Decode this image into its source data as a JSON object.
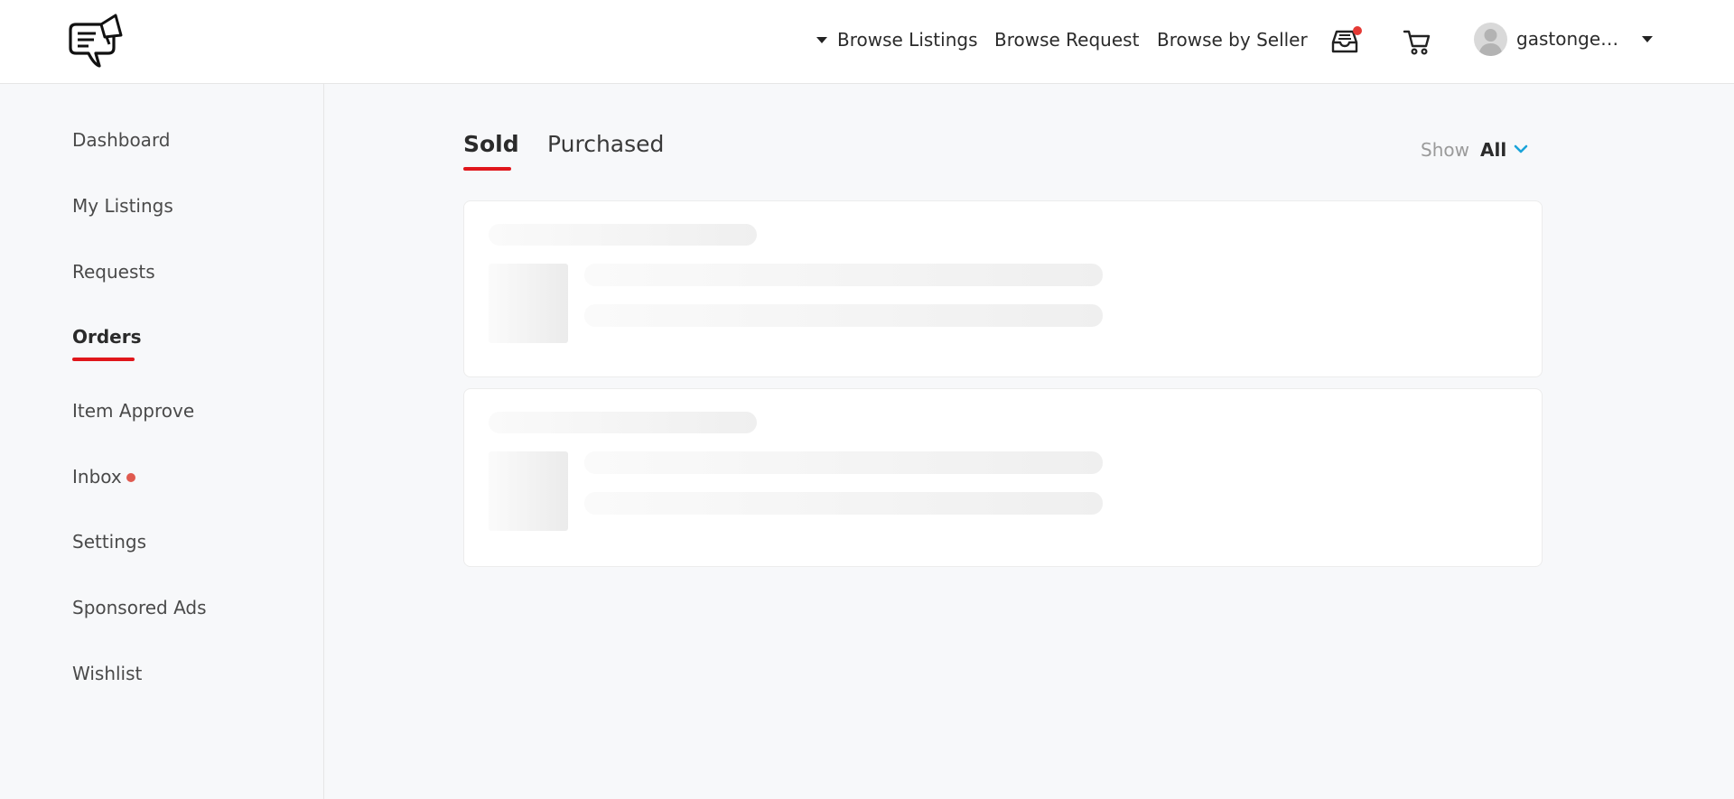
{
  "header": {
    "nav": {
      "browse_listings": "Browse Listings",
      "browse_request": "Browse Request",
      "browse_by_seller": "Browse by Seller"
    },
    "icons": {
      "logo": "megaphone-chat-logo",
      "inbox": "inbox-tray-icon",
      "cart": "shopping-cart-icon",
      "avatar": "user-avatar"
    },
    "inbox_has_notification": true,
    "username": "gastongena..."
  },
  "sidebar": {
    "items": [
      {
        "label": "Dashboard"
      },
      {
        "label": "My Listings"
      },
      {
        "label": "Requests"
      },
      {
        "label": "Orders",
        "active": true
      },
      {
        "label": "Item Approve"
      },
      {
        "label": "Inbox",
        "has_notification": true
      },
      {
        "label": "Settings"
      },
      {
        "label": "Sponsored Ads"
      },
      {
        "label": "Wishlist"
      }
    ]
  },
  "main": {
    "tabs": [
      {
        "label": "Sold",
        "active": true
      },
      {
        "label": "Purchased",
        "active": false
      }
    ],
    "filter": {
      "label": "Show",
      "value": "All"
    },
    "loading_cards": 2
  },
  "colors": {
    "accent": "#e0161b",
    "notification": "#e53935",
    "chevron": "#1aa3d9",
    "background": "#f7f8fa"
  }
}
